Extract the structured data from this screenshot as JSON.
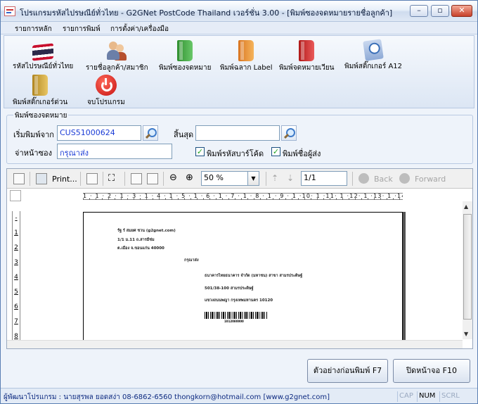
{
  "window": {
    "title": "โปรแกรมรหัสไปรษณีย์ทั่วไทย - G2GNet PostCode Thailand เวอร์ชั่น 3.00 - [พิมพ์ซองจดหมายรายชื่อลูกค้า]",
    "minimize": "–",
    "maximize": "▫",
    "close": "✕"
  },
  "menu": [
    "รายการหลัก",
    "รายการพิมพ์",
    "การตั้งค่า/เครื่องมือ"
  ],
  "toolbar": [
    {
      "label": "รหัสไปรษณีย์ทั่วไทย",
      "icon": "thai-flag-icon"
    },
    {
      "label": "รายชื่อลูกค้า/สมาชิก",
      "icon": "users-icon"
    },
    {
      "label": "พิมพ์ซองจดหมาย",
      "icon": "green-folder-icon"
    },
    {
      "label": "พิมพ์ฉลาก Label",
      "icon": "orange-folder-icon"
    },
    {
      "label": "พิมพ์จดหมายเวียน",
      "icon": "red-folder-icon"
    },
    {
      "label": "พิมพ์สติ๊กเกอร์ A12",
      "icon": "sticker-icon"
    },
    {
      "label": "พิมพ์สติ๊กเกอร์ด่วน",
      "icon": "gold-folder-icon"
    },
    {
      "label": "จบโปรแกรม",
      "icon": "power-icon"
    }
  ],
  "form": {
    "group_title": "พิมพ์ซองจดหมาย",
    "start_label": "เริ่มพิมพ์จาก",
    "start_value": "CUS51000624",
    "end_label": "สิ้นสุด",
    "end_value": "",
    "address_label": "จ่าหน้าซอง",
    "address_value": "กรุณาส่ง",
    "barcode_label": "พิมพ์รหัสบาร์โค้ด",
    "barcode_checked": true,
    "sender_label": "พิมพ์ชื่อผู้ส่ง",
    "sender_checked": true,
    "check_mark": "✓"
  },
  "preview": {
    "print_label": "Print...",
    "zoom": "50 %",
    "page": "1/1",
    "back_label": "Back",
    "forward_label": "Forward",
    "ruler_top": "1 · 1 · 2 · 1 · 3 · 1 · 4 · 1 · 5 · 1 · 6 · 1 · 7 · 1 · 8 · 1 · 9 · 1 ·10· 1 ·11· 1 ·12· 1 ·13· 1 ·14· 1 ·15· 1 ·16· 1 ·17· 1 ·18· 1 ·19· 1 ·20· 1 ·21· 1 ·22· 1 ·23",
    "ruler_left": [
      "-",
      "1",
      "2",
      "3",
      "4",
      "5",
      "6",
      "7",
      "8",
      "9"
    ],
    "envelope": {
      "sender_line1": "รัฐ ร์ สมยศ ชวน (g2gnet.com)",
      "sender_line2": "1/1 ม.11 ถ.สารมีช่ม",
      "sender_line3": "ต.เมือง จ.ขอนแก่น 40000",
      "attention": "กรุณาส่ง",
      "recipient_line1": "ธนาคารไทยธนาคาร จำกัด (มหาชน) สาขา สามรประดิษฐ์",
      "recipient_line2": "501/38-100 สามรประดิษฐ์",
      "recipient_line3": "แขวงถนนพญา  กรุงเทพมหานคร  10120",
      "barcode_number": "1012080000"
    }
  },
  "buttons": {
    "print_preview": "ตัวอย่างก่อนพิมพ์ F7",
    "close_screen": "ปิดหน้าจอ F10"
  },
  "status": {
    "developer": "ผู้พัฒนาโปรแกรม : นายสุรพล ยอดสง่า 08-6862-6560 thongkorn@hotmail.com [www.g2gnet.com]",
    "cap": "CAP",
    "num": "NUM",
    "scrl": "SCRL"
  }
}
